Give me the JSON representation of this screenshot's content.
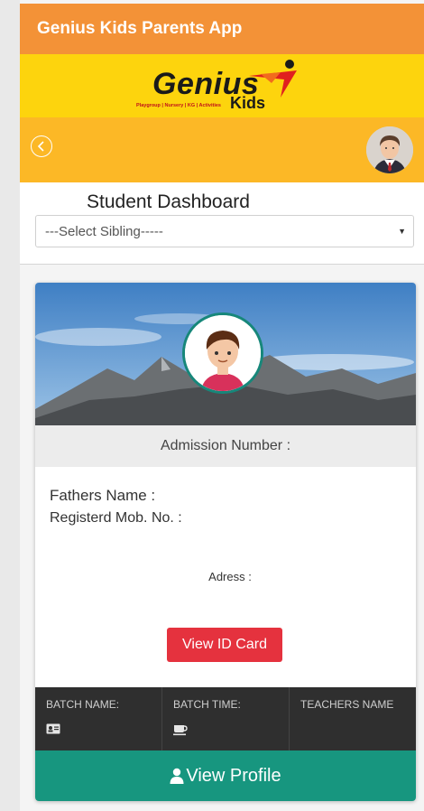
{
  "app": {
    "title": "Genius Kids Parents App"
  },
  "logo": {
    "word": "Genius",
    "sub": "Kids",
    "tagline": "Playgroup | Nursery | KG | Activities"
  },
  "dashboard": {
    "title": "Student Dashboard",
    "sibling_select": {
      "selected": "---Select Sibling-----"
    }
  },
  "card": {
    "admission_label": "Admission Number :",
    "fathers_label": "Fathers Name :",
    "mobile_label": "Registerd Mob. No. :",
    "address_label": "Adress :",
    "id_card_button": "View ID Card",
    "batch": {
      "name_label": "BATCH NAME:",
      "time_label": "BATCH TIME:",
      "teacher_label": "TEACHERS NAME"
    },
    "profile_button": "View Profile"
  },
  "icons": {
    "back": "back-arrow-circle-icon",
    "user_avatar": "user-avatar-icon",
    "student_avatar": "student-avatar-icon",
    "id_card": "id-card-icon",
    "coffee": "coffee-cup-icon",
    "user": "user-icon"
  },
  "colors": {
    "topbar": "#f39237",
    "logo_band": "#fdd40d",
    "navbar": "#fcb826",
    "id_button": "#e5323e",
    "profile_button": "#17967f",
    "batch_bar": "#2f2f2f"
  }
}
